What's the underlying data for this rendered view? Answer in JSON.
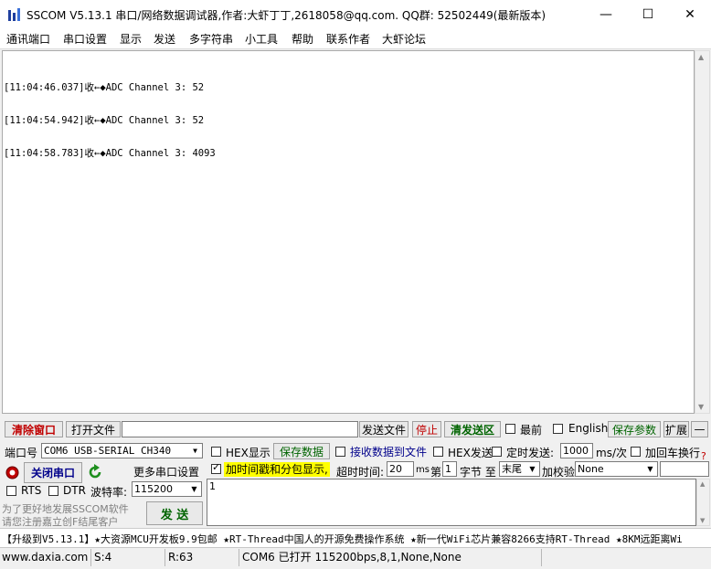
{
  "window": {
    "title": "SSCOM V5.13.1 串口/网络数据调试器,作者:大虾丁丁,2618058@qq.com. QQ群: 52502449(最新版本)",
    "minimize": "—",
    "maximize": "☐",
    "close": "✕"
  },
  "menu": [
    "通讯端口",
    "串口设置",
    "显示",
    "发送",
    "多字符串",
    "小工具",
    "帮助",
    "联系作者",
    "大虾论坛"
  ],
  "receive": {
    "lines": [
      "[11:04:46.037]收←◆ADC Channel 3: 52",
      "[11:04:54.942]收←◆ADC Channel 3: 52",
      "[11:04:58.783]收←◆ADC Channel 3: 4093"
    ]
  },
  "toolbar1": {
    "clear_window": "清除窗口",
    "open_file": "打开文件",
    "file_path": "",
    "send_file": "发送文件",
    "stop": "停止",
    "clear_send": "清发送区",
    "topmost": "最前",
    "english": "English",
    "save_params": "保存参数",
    "expand": "扩展",
    "collapse": "—"
  },
  "toolbar2": {
    "port_label": "端口号",
    "port_value": "COM6 USB-SERIAL CH340",
    "hex_display": "HEX显示",
    "save_data": "保存数据",
    "recv_to_file": "接收数据到文件",
    "hex_send": "HEX发送",
    "timed_send": "定时发送:",
    "interval": "1000",
    "interval_unit": "ms/次",
    "add_crlf": "加回车换行",
    "more": "?"
  },
  "toolbar3": {
    "close_port": "关闭串口",
    "more_settings": "更多串口设置",
    "timestamp_label": "加时间戳和分包显示,",
    "timeout_label": "超时时间:",
    "timeout_value": "20",
    "timeout_unit": "ms",
    "nth_label": "第",
    "nth_value": "1",
    "byte_label": "字节 至",
    "end_value": "末尾",
    "checksum_label": "加校验",
    "checksum_value": "None"
  },
  "toolbar4": {
    "rts": "RTS",
    "dtr": "DTR",
    "baud_label": "波特率:",
    "baud_value": "115200"
  },
  "send": {
    "text": "1",
    "button": "发 送",
    "promo_line1": "为了更好地发展SSCOM软件",
    "promo_line2": "请您注册嘉立创F结尾客户"
  },
  "ticker": "【升级到V5.13.1】★大资源MCU开发板9.9包邮 ★RT-Thread中国人的开源免费操作系统 ★新一代WiFi芯片兼容8266支持RT-Thread ★8KM远距离Wi",
  "status": {
    "url": "www.daxia.com",
    "sent": "S:4",
    "received": "R:63",
    "port_status": "COM6 已打开  115200bps,8,1,None,None"
  },
  "colors": {
    "accent_red": "#c00000",
    "accent_green": "#006400",
    "accent_blue": "#00008b",
    "highlight_yellow": "#ffff00"
  }
}
